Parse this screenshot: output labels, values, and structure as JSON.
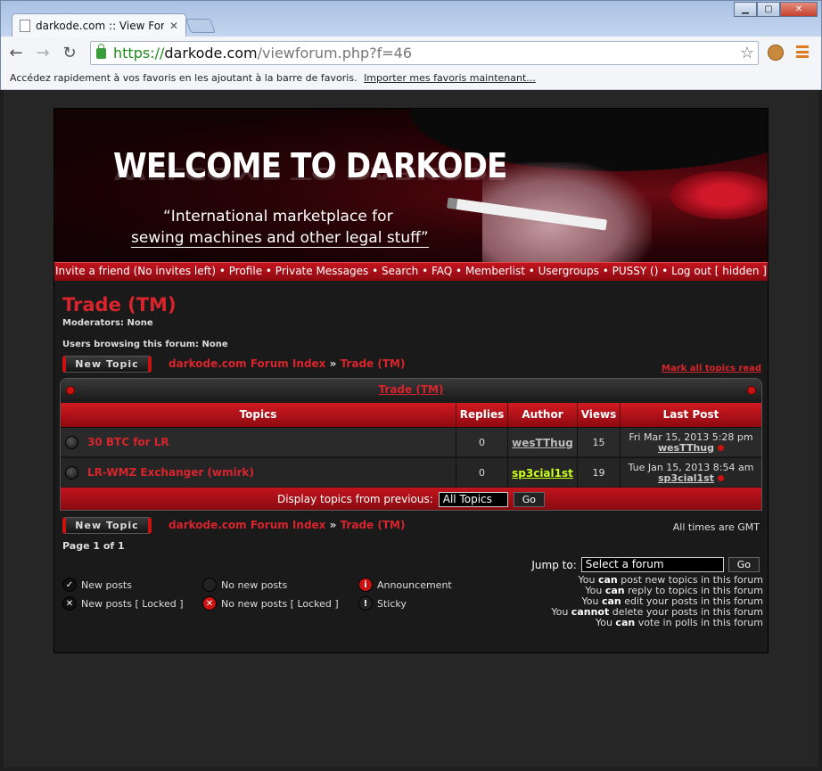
{
  "browser": {
    "tab_title": "darkode.com :: View Forum",
    "url_scheme": "https://",
    "url_host": "darkode.com",
    "url_path": "/viewforum.php?f=46",
    "bookmark_prompt": "Accédez rapidement à vos favoris en les ajoutant à la barre de favoris.",
    "bookmark_import": "Importer mes favoris maintenant..."
  },
  "banner": {
    "title": "WELCOME TO DARKODE",
    "tagline_1": "“International marketplace for",
    "tagline_2": "sewing machines and other legal stuff”"
  },
  "nav": {
    "items": [
      "Invite a friend (No invites left)",
      "Profile",
      "Private Messages",
      "Search",
      "FAQ",
      "Memberlist",
      "Usergroups",
      "PUSSY ()",
      "Log out [ hidden ]"
    ],
    "separator": " • "
  },
  "forum": {
    "title": "Trade (TM)",
    "moderators": "Moderators: None",
    "browsing": "Users browsing this forum: None",
    "new_topic_label": "New Topic",
    "crumb_index": "darkode.com Forum Index",
    "crumb_sep": "»",
    "crumb_forum": "Trade (TM)",
    "mark_all": "Mark all topics read",
    "table_title": "Trade (TM)",
    "columns": [
      "Topics",
      "Replies",
      "Author",
      "Views",
      "Last Post"
    ],
    "topics": [
      {
        "title": "30 BTC for LR",
        "replies": "0",
        "author": "wesTThug",
        "views": "15",
        "last_date": "Fri Mar 15, 2013 5:28 pm",
        "last_user": "wesTThug"
      },
      {
        "title": "LR-WMZ Exchanger (wmirk)",
        "replies": "0",
        "author": "sp3cial1st",
        "views": "19",
        "last_date": "Tue Jan 15, 2013 8:54 am",
        "last_user": "sp3cial1st"
      }
    ],
    "display_label": "Display topics from previous:",
    "display_value": "All Topics",
    "go_label": "Go",
    "all_times": "All times are GMT",
    "page_label": "Page 1 of 1",
    "jump_label": "Jump to:",
    "jump_value": "Select a forum",
    "permissions": [
      {
        "pre": "You ",
        "verb": "can",
        "post": " post new topics in this forum"
      },
      {
        "pre": "You ",
        "verb": "can",
        "post": " reply to topics in this forum"
      },
      {
        "pre": "You ",
        "verb": "can",
        "post": " edit your posts in this forum"
      },
      {
        "pre": "You ",
        "verb": "cannot",
        "post": " delete your posts in this forum"
      },
      {
        "pre": "You ",
        "verb": "can",
        "post": " vote in polls in this forum"
      }
    ],
    "legend": {
      "new_posts": "New posts",
      "no_new_posts": "No new posts",
      "announcement": "Announcement",
      "new_locked": "New posts [ Locked ]",
      "no_new_locked": "No new posts [ Locked ]",
      "sticky": "Sticky"
    }
  },
  "colors": {
    "accent_red": "#d8242c",
    "author_highlight": "#c8ff1a"
  }
}
